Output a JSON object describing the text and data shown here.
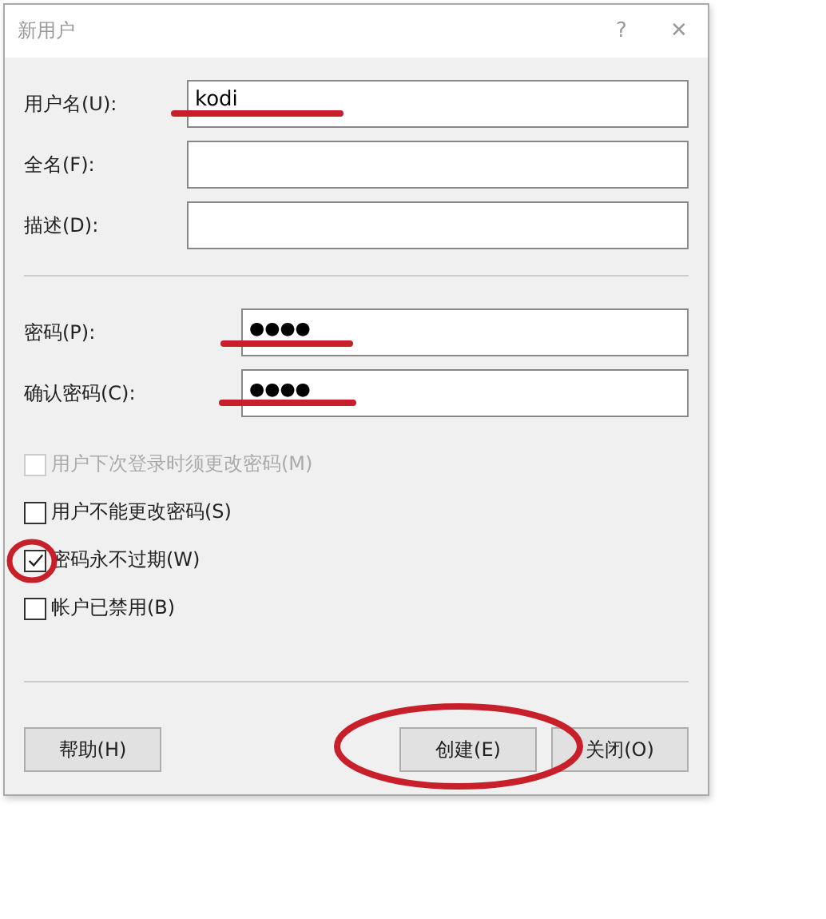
{
  "window": {
    "title": "新用户",
    "help": "?",
    "close": "✕"
  },
  "fields": [
    {
      "label": "用户名(U):",
      "value": "kodi"
    },
    {
      "label": "全名(F):"
    },
    {
      "label": "描述(D):"
    }
  ],
  "password_fields": [
    {
      "label": "密码(P):",
      "value": "●●●●"
    },
    {
      "label": "确认密码(C):",
      "value": "●●●●"
    }
  ],
  "checkboxes": [
    {
      "label": "用户下次登录时须更改密码(M)",
      "checked": false,
      "disabled": true
    },
    {
      "label": "用户不能更改密码(S)",
      "checked": false,
      "disabled": false
    },
    {
      "label": "密码永不过期(W)",
      "checked": true,
      "disabled": false
    },
    {
      "label": "帐户已禁用(B)",
      "checked": false,
      "disabled": false
    }
  ],
  "buttons": {
    "help": "帮助(H)",
    "create": "创建(E)",
    "close": "关闭(O)"
  }
}
